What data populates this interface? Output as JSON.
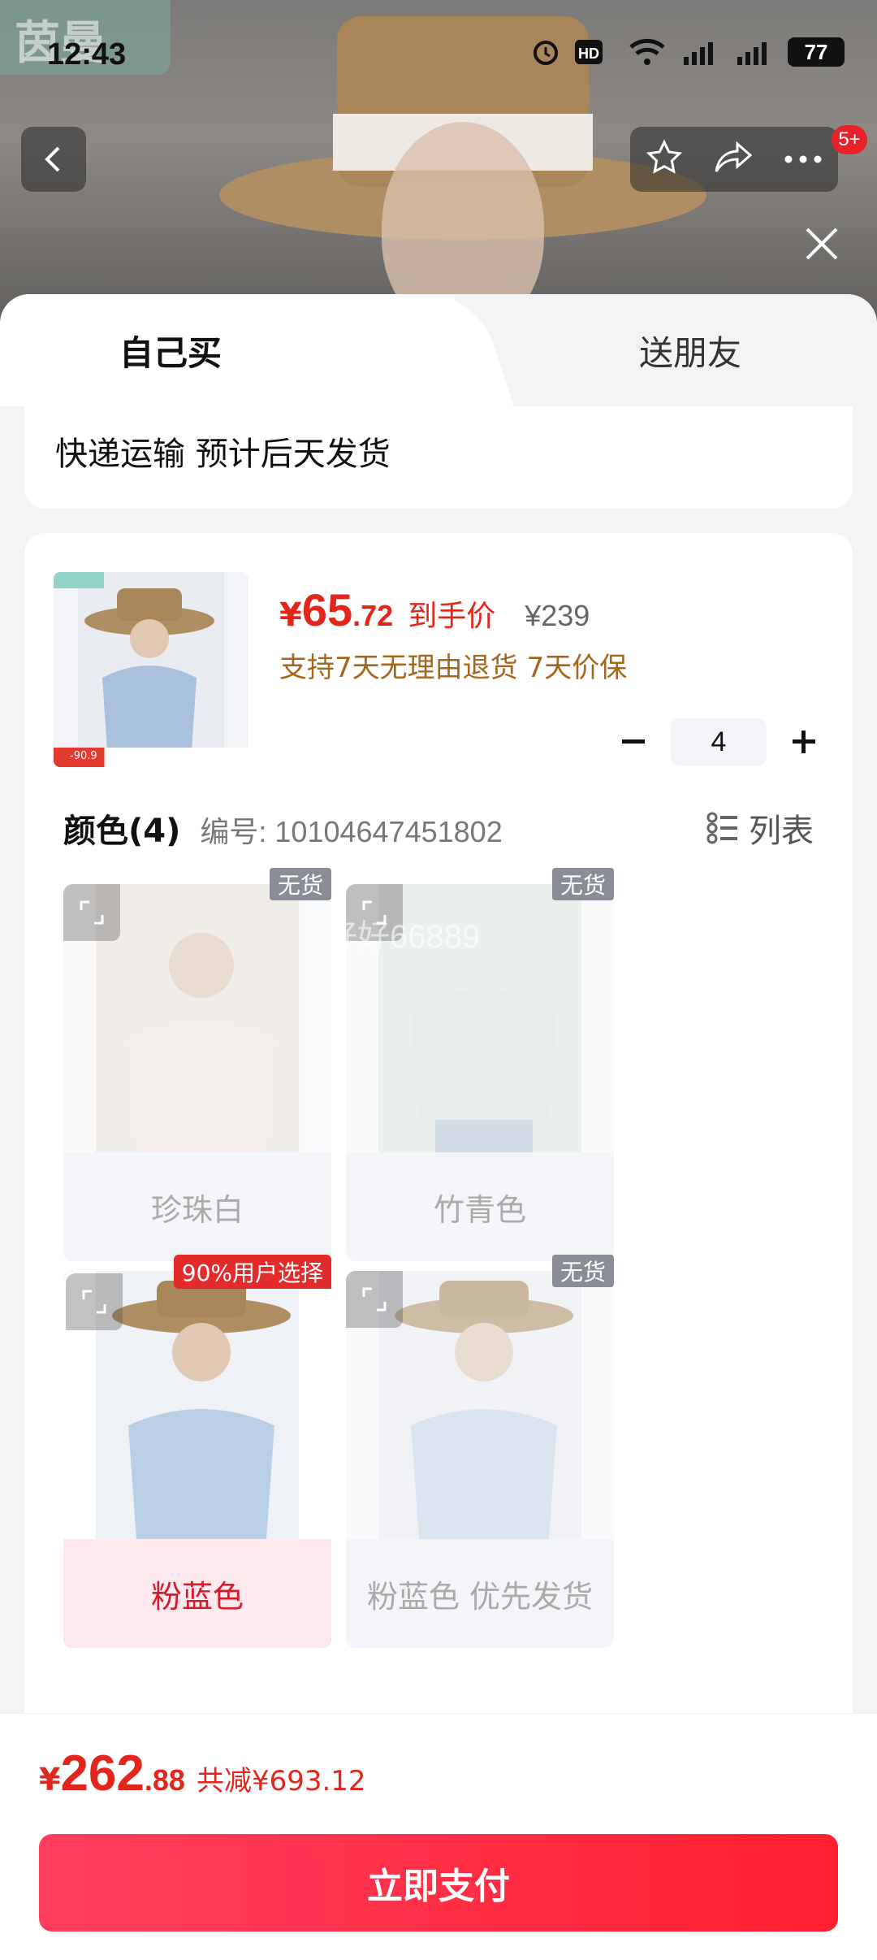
{
  "status": {
    "time": "12:43",
    "battery": "77"
  },
  "watermark": "茵曼",
  "nav": {
    "badge": "5+"
  },
  "tabs": [
    {
      "label": "自己买"
    },
    {
      "label": "送朋友"
    }
  ],
  "shipping": {
    "text": "快递运输 预计后天发货"
  },
  "product": {
    "price_symbol": "¥",
    "price_int": "65",
    "price_dec": ".72",
    "price_label": "到手价",
    "original_price": "¥239",
    "promise": "支持7天无理由退货 7天价保",
    "quantity": "4",
    "thumb_strip": "-90.9"
  },
  "color_section": {
    "title": "颜色(4)",
    "code": "编号: 10104647451802",
    "toggle_label": "列表"
  },
  "variants": [
    {
      "name": "珍珠白",
      "badge": "无货",
      "state": "disabled",
      "color": "#f3eadf"
    },
    {
      "name": "竹青色",
      "badge": "无货",
      "state": "disabled",
      "color": "#dfeae2"
    },
    {
      "name": "粉蓝色",
      "badge": "90%用户选择",
      "state": "selected",
      "color": "#b9cfe6"
    },
    {
      "name": "粉蓝色 优先发货",
      "badge": "无货",
      "state": "disabled",
      "color": "#c7d8ea"
    }
  ],
  "overlay_watermark": "好好66889",
  "footer": {
    "total_symbol": "¥",
    "total_int": "262",
    "total_dec": ".88",
    "saving": "共减¥693.12",
    "pay_label": "立即支付"
  },
  "colors": {
    "accent_red": "#e3261c",
    "promise_brown": "#a5651a",
    "pay_gradient_start": "#ff3f5e",
    "pay_gradient_end": "#ff1f2f"
  }
}
